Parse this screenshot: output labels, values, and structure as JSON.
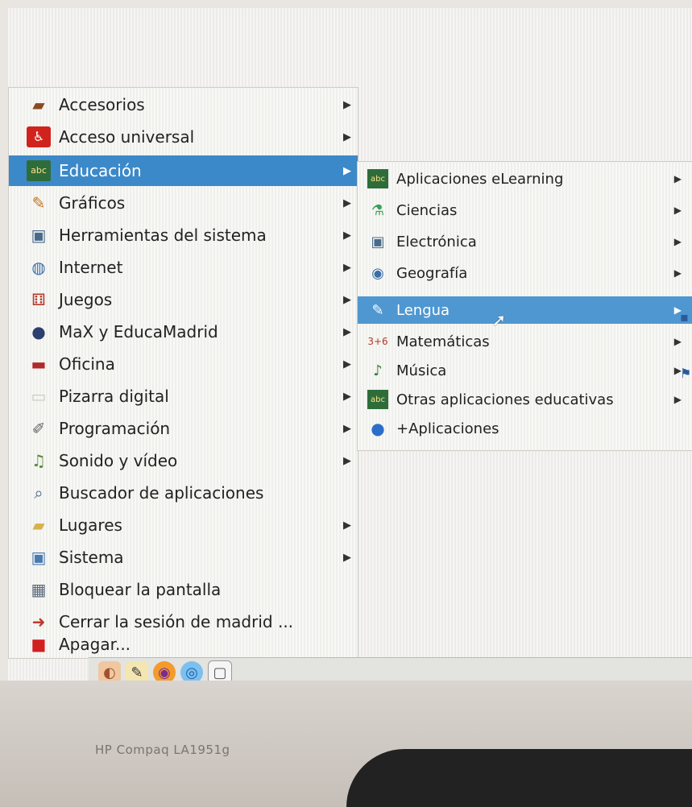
{
  "monitor": {
    "brand": "HP Compaq LA1951g"
  },
  "main_menu": {
    "items": [
      {
        "label": "Accesorios",
        "icon": "accessories-icon",
        "submenu": true
      },
      {
        "label": "Acceso universal",
        "icon": "accessibility-icon",
        "submenu": true
      },
      {
        "label": "Educación",
        "icon": "education-icon",
        "submenu": true,
        "active": true
      },
      {
        "label": "Gráficos",
        "icon": "graphics-icon",
        "submenu": true
      },
      {
        "label": "Herramientas del sistema",
        "icon": "system-tools-icon",
        "submenu": true
      },
      {
        "label": "Internet",
        "icon": "internet-icon",
        "submenu": true
      },
      {
        "label": "Juegos",
        "icon": "games-icon",
        "submenu": true
      },
      {
        "label": "MaX y EducaMadrid",
        "icon": "max-icon",
        "submenu": true
      },
      {
        "label": "Oficina",
        "icon": "office-icon",
        "submenu": true
      },
      {
        "label": "Pizarra digital",
        "icon": "whiteboard-icon",
        "submenu": true
      },
      {
        "label": "Programación",
        "icon": "programming-icon",
        "submenu": true
      },
      {
        "label": "Sonido y vídeo",
        "icon": "sound-video-icon",
        "submenu": true
      },
      {
        "label": "Buscador de aplicaciones",
        "icon": "app-finder-icon",
        "submenu": false
      },
      {
        "label": "Lugares",
        "icon": "places-icon",
        "submenu": true
      },
      {
        "label": "Sistema",
        "icon": "system-icon",
        "submenu": true
      },
      {
        "label": "Bloquear la pantalla",
        "icon": "lock-screen-icon",
        "submenu": false
      },
      {
        "label": "Cerrar la sesión de madrid ...",
        "icon": "logout-icon",
        "submenu": false
      },
      {
        "label": "Apagar...",
        "icon": "shutdown-icon",
        "submenu": false
      }
    ]
  },
  "sub_menu": {
    "items": [
      {
        "label": "Aplicaciones eLearning",
        "icon": "elearning-icon"
      },
      {
        "label": "Ciencias",
        "icon": "science-icon"
      },
      {
        "label": "Electrónica",
        "icon": "electronics-icon"
      },
      {
        "label": "Geografía",
        "icon": "geography-icon"
      },
      {
        "label": "Lengua",
        "icon": "language-icon",
        "active": true
      },
      {
        "label": "Matemáticas",
        "icon": "math-icon"
      },
      {
        "label": "Música",
        "icon": "music-icon"
      },
      {
        "label": "Otras aplicaciones educativas",
        "icon": "other-education-icon"
      },
      {
        "label": "+Aplicaciones",
        "icon": "more-apps-icon",
        "submenu": false
      }
    ]
  },
  "arrow_glyph": "▶",
  "taskbar": {
    "icons": [
      "menu-icon",
      "editor-icon",
      "firefox-icon",
      "browser-icon",
      "files-icon"
    ]
  },
  "colors": {
    "highlight": "#3c89c9",
    "highlight_sub": "#4f97d1"
  }
}
